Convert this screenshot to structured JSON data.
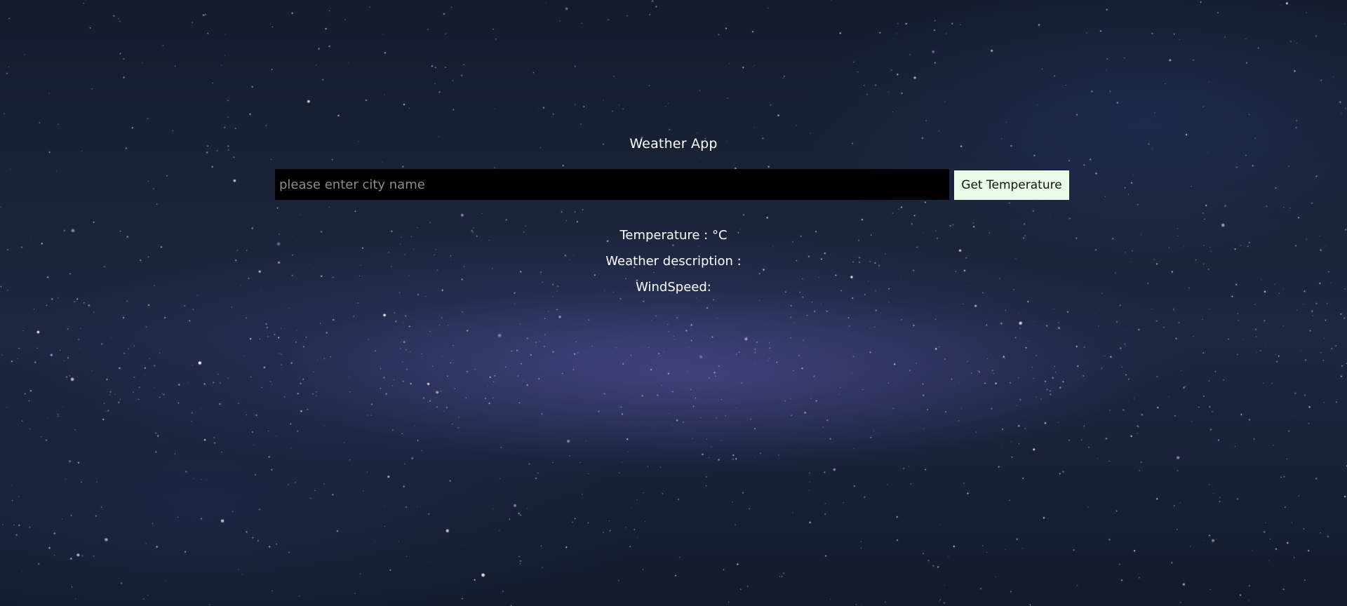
{
  "app": {
    "title": "Weather App"
  },
  "search": {
    "placeholder": "please enter city name",
    "value": "",
    "button_label": "Get Temperature"
  },
  "results": {
    "temperature_label": "Temperature : °C",
    "description_label": "Weather description :",
    "windspeed_label": "WindSpeed:"
  },
  "colors": {
    "background": "#1a2338",
    "input_background": "#000000",
    "button_background": "#e8fce8",
    "text": "#ffffff"
  }
}
